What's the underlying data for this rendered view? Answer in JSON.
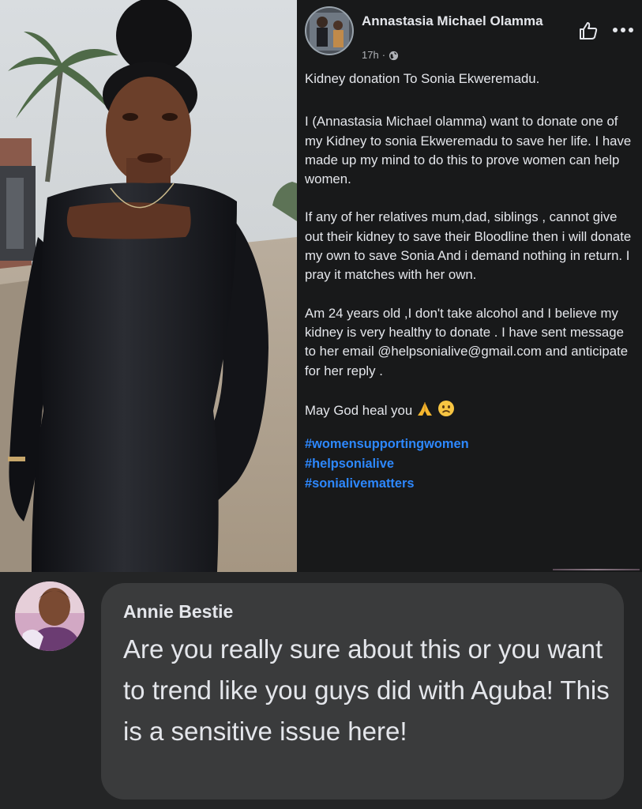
{
  "post": {
    "author_name": "Annastasia Michael Olamma",
    "timestamp": "17h",
    "separator": "·",
    "title": "Kidney donation To Sonia Ekweremadu.",
    "paragraphs": [
      "I (Annastasia Michael olamma) want to donate one of my Kidney to sonia Ekweremadu to save her life. I have made up my mind to do this to prove women can help women.",
      "If any of her relatives mum,dad, siblings , cannot give out their kidney to save their Bloodline then i will donate my own to save Sonia And i demand nothing in return. I pray it matches with her own.",
      "Am 24 years old ,I don't take alcohol and  I believe my kidney is very healthy to donate . I have sent message to her email @helpsonialive@gmail.com and anticipate for her reply ."
    ],
    "closing": "May God heal you",
    "closing_emojis": [
      "pray-emoji",
      "sad-face-emoji"
    ],
    "hashtags": [
      "#womensupportingwomen",
      "#helpsonialive",
      "#sonialivematters"
    ],
    "icons": {
      "like": "thumbs-up-icon",
      "more": "more-options-icon",
      "audience": "globe-icon"
    }
  },
  "comment": {
    "author_name": "Annie Bestie",
    "text": "Are you really sure about this or you want to trend like you guys did with Aguba! This is a sensitive issue here!"
  },
  "colors": {
    "background": "#18191a",
    "comment_background": "#242526",
    "bubble": "#3a3b3c",
    "text": "#e4e6eb",
    "secondary_text": "#b0b3b8",
    "hashtag": "#2d88ff"
  }
}
